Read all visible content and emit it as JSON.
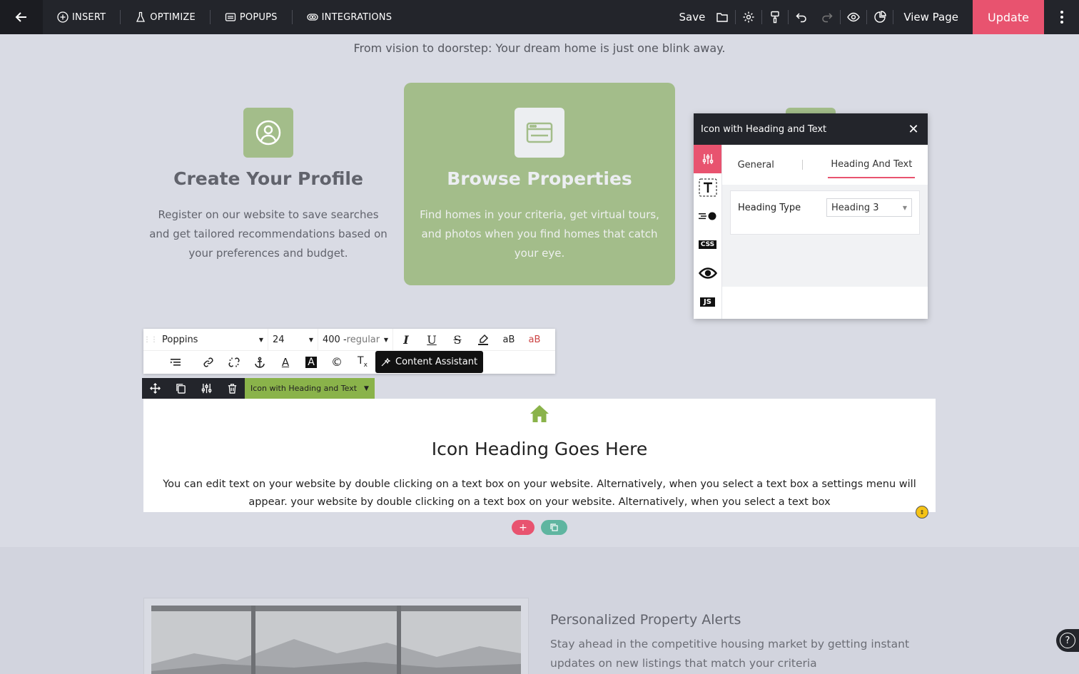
{
  "topbar": {
    "insert": "INSERT",
    "optimize": "OPTIMIZE",
    "popups": "POPUPS",
    "integrations": "INTEGRATIONS",
    "save": "Save",
    "view_page": "View Page",
    "update": "Update"
  },
  "page": {
    "subtitle": "From vision to doorstep: Your dream home is just one blink away.",
    "cards": [
      {
        "title": "Create Your Profile",
        "text": "Register on our website to save searches and get tailored recommendations based on your preferences and budget.",
        "icon": "user-circle-icon"
      },
      {
        "title": "Browse Properties",
        "text": "Find homes in your criteria, get virtual tours, and photos when you find homes that catch your eye.",
        "icon": "browser-window-icon"
      }
    ],
    "accent_green": "#a3bd8a"
  },
  "panel": {
    "title": "Icon with Heading and Text",
    "tabs": [
      "General",
      "Heading And Text"
    ],
    "active_tab": "Heading And Text",
    "field_label": "Heading Type",
    "field_value": "Heading 3",
    "side_css": "CSS",
    "side_js": "JS"
  },
  "rte": {
    "font_family": "Poppins",
    "font_size": "24",
    "font_weight": "400 -",
    "font_weight_style": "regular",
    "content_assistant": "Content Assistant"
  },
  "element_toolbar": {
    "name": "Icon with Heading and Text"
  },
  "selected": {
    "heading": "Icon Heading Goes Here",
    "text": "You can edit text on your website by double clicking on a text box on your website. Alternatively, when you select a text box a settings menu will appear. your website by double clicking on a text box on your website. Alternatively, when you select a text box",
    "add": "+"
  },
  "feature": {
    "title": "Personalized Property Alerts",
    "text": "Stay ahead in the competitive housing market by getting instant updates on new listings that match your criteria"
  },
  "help": "?",
  "colors": {
    "brand_pink": "#e8536f",
    "dark": "#23252b",
    "element_green": "#8ab34a"
  }
}
